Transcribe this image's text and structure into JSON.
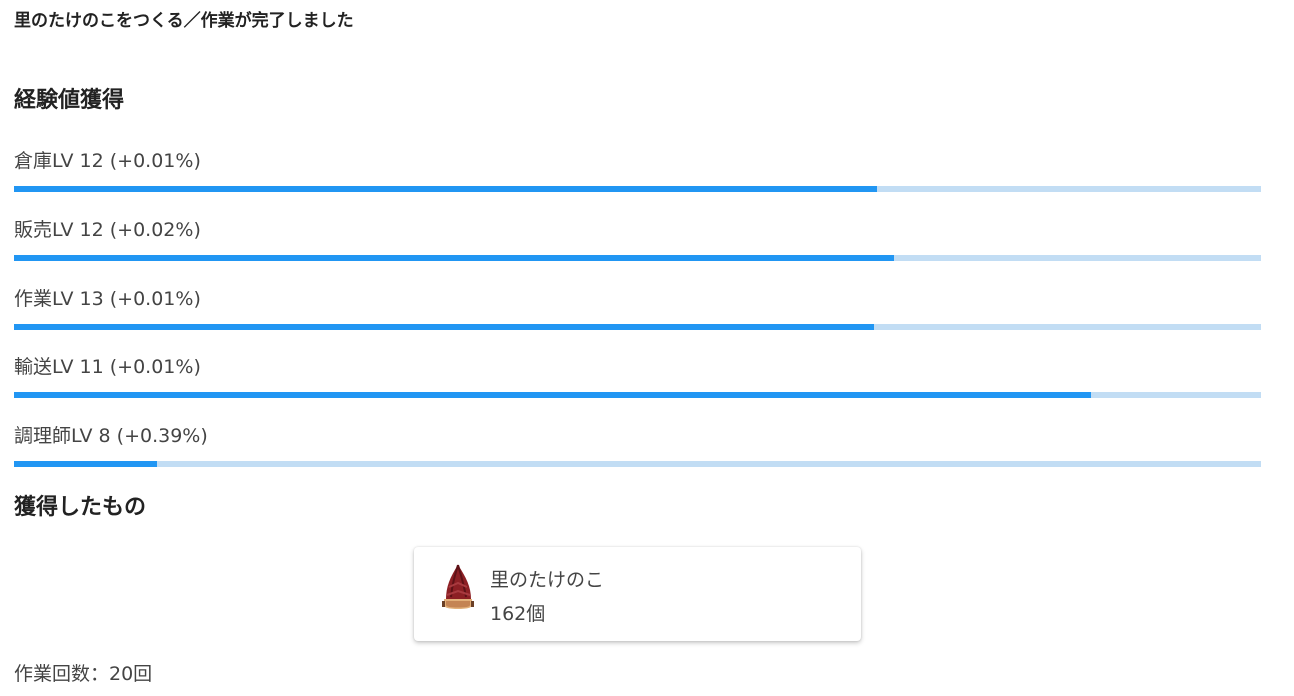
{
  "header": {
    "title": "里のたけのこをつくる／作業が完了しました"
  },
  "experience": {
    "heading": "経験値獲得",
    "skills": [
      {
        "label": "倉庫LV 12 (+0.01%)",
        "progress": 0.692
      },
      {
        "label": "販売LV 12 (+0.02%)",
        "progress": 0.706
      },
      {
        "label": "作業LV 13 (+0.01%)",
        "progress": 0.69
      },
      {
        "label": "輸送LV 11 (+0.01%)",
        "progress": 0.864
      },
      {
        "label": "調理師LV 8 (+0.39%)",
        "progress": 0.115
      }
    ],
    "colors": {
      "fill": "#2196f3",
      "track": "#c2ddf4"
    }
  },
  "acquired": {
    "heading": "獲得したもの",
    "item": {
      "icon": "bamboo-shoot-icon",
      "name": "里のたけのこ",
      "quantity": "162個"
    }
  },
  "footer": {
    "work_count": "作業回数：20回"
  }
}
